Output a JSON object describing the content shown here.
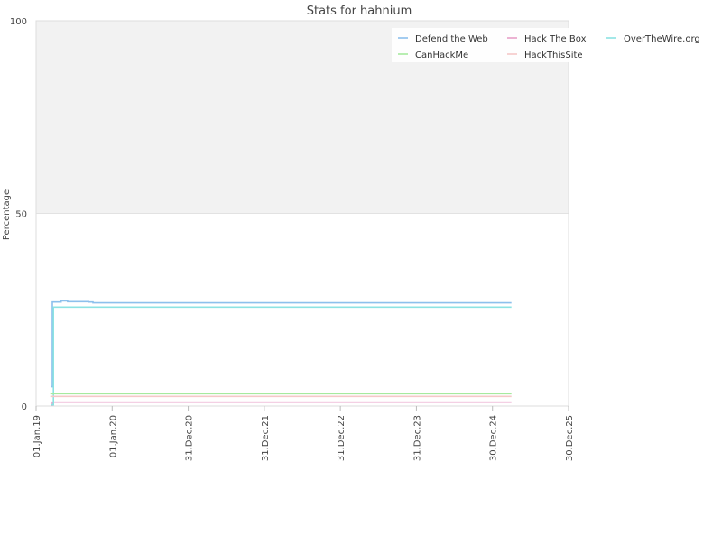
{
  "chart_data": {
    "type": "line",
    "title": "Stats for hahnium",
    "xlabel": "",
    "ylabel": "Percentage",
    "ylim": [
      0,
      100
    ],
    "yticks": [
      0,
      50,
      100
    ],
    "ytick_labels": [
      "0",
      "50",
      "100"
    ],
    "xlim": [
      "2019-01-01",
      "2025-12-30"
    ],
    "xticks": [
      "2019-01-01",
      "2020-01-01",
      "2020-12-31",
      "2021-12-31",
      "2022-12-31",
      "2023-12-31",
      "2024-12-30",
      "2025-12-30"
    ],
    "xtick_labels": [
      "01.Jan.19",
      "01.Jan.20",
      "31.Dec.20",
      "31.Dec.21",
      "31.Dec.22",
      "31.Dec.23",
      "30.Dec.24",
      "30.Dec.25"
    ],
    "background_bands": [
      {
        "from": 50,
        "to": 100,
        "color": "#f2f2f2"
      },
      {
        "from": 0,
        "to": 50,
        "color": "#ffffff"
      }
    ],
    "legend_position": "top-right",
    "series": [
      {
        "name": "Defend the Web",
        "color": "#8cc0ec",
        "points": [
          [
            "2019-03-15",
            5
          ],
          [
            "2019-03-20",
            27
          ],
          [
            "2019-05-01",
            27.3
          ],
          [
            "2019-06-01",
            27.1
          ],
          [
            "2019-09-10",
            27
          ],
          [
            "2019-10-01",
            26.8
          ],
          [
            "2025-03-31",
            26.8
          ]
        ]
      },
      {
        "name": "Hack The Box",
        "color": "#e8a0c8",
        "points": [
          [
            "2019-03-15",
            0.2
          ],
          [
            "2019-03-20",
            1
          ],
          [
            "2025-03-31",
            1
          ]
        ]
      },
      {
        "name": "OverTheWire.org",
        "color": "#8ce3e3",
        "points": [
          [
            "2019-03-15",
            0.3
          ],
          [
            "2019-03-25",
            25.7
          ],
          [
            "2025-03-31",
            25.7
          ]
        ]
      },
      {
        "name": "CanHackMe",
        "color": "#a6ea9e",
        "points": [
          [
            "2019-03-10",
            3.2
          ],
          [
            "2025-03-31",
            3.2
          ]
        ]
      },
      {
        "name": "HackThisSite",
        "color": "#f5c8c8",
        "points": [
          [
            "2019-03-10",
            2.5
          ],
          [
            "2025-03-31",
            2.5
          ]
        ]
      }
    ]
  }
}
